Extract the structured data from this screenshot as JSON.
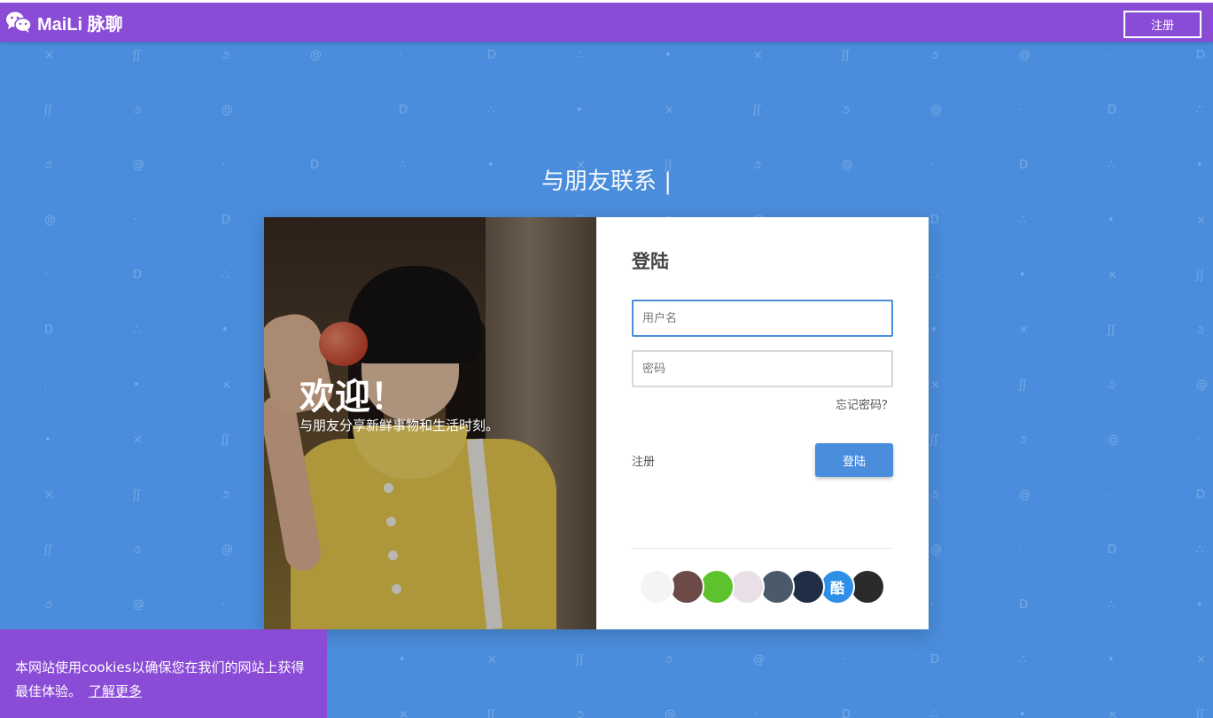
{
  "header": {
    "brand_name": "MaiLi 脉聊",
    "register_label": "注册"
  },
  "headline": "与朋友联系 |",
  "hero": {
    "title": "欢迎！",
    "subtitle": "与朋友分享新鲜事物和生活时刻。"
  },
  "login": {
    "title": "登陆",
    "username_placeholder": "用户名",
    "password_placeholder": "密码",
    "forgot_label": "忘记密码？",
    "register_label": "注册",
    "submit_label": "登陆"
  },
  "avatars": {
    "items": [
      {
        "name": "avatar-1",
        "color": "#f4f4f4"
      },
      {
        "name": "avatar-2",
        "color": "#6b4a48"
      },
      {
        "name": "avatar-3",
        "color": "#5ec22c"
      },
      {
        "name": "avatar-4",
        "color": "#e9dfe6"
      },
      {
        "name": "avatar-5",
        "color": "#4b5a6a"
      },
      {
        "name": "avatar-6",
        "color": "#1f2e45"
      },
      {
        "name": "avatar-7",
        "color": "#2d8fe6",
        "glyph": "酷"
      },
      {
        "name": "avatar-8",
        "color": "#2a2a2a"
      }
    ]
  },
  "cookie": {
    "message": "本网站使用cookies以确保您在我们的网站上获得最佳体验。",
    "link_label": "了解更多"
  },
  "colors": {
    "background": "#4a8ddc",
    "accent_purple": "#8a4bd6",
    "button_blue": "#4a8ddc"
  }
}
